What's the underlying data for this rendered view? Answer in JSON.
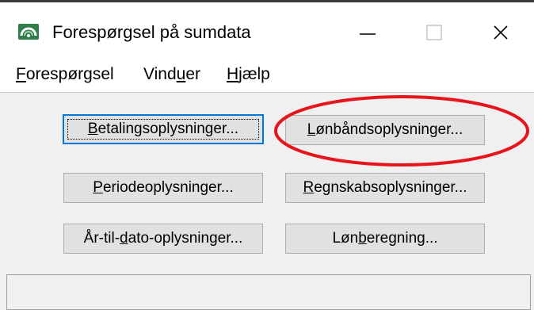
{
  "window": {
    "title": "Forespørgsel på sumdata",
    "app_icon": "green-dashboard-icon"
  },
  "titlebar_controls": {
    "minimize": "minimize-icon",
    "maximize": "maximize-icon",
    "close": "close-icon"
  },
  "menu": {
    "items": [
      {
        "first": "F",
        "rest": "orespørgsel",
        "underline_pos": "first"
      },
      {
        "pre": "Vind",
        "underlined": "u",
        "post": "er"
      },
      {
        "first": "H",
        "rest": "jælp",
        "underline_pos": "first"
      }
    ]
  },
  "buttons": {
    "betaling": {
      "pre": "",
      "ul": "B",
      "post": "etalingsoplysninger..."
    },
    "lonbands": {
      "pre": "",
      "ul": "L",
      "post": "ønbåndsoplysninger..."
    },
    "periode": {
      "pre": "",
      "ul": "P",
      "post": "eriodeoplysninger..."
    },
    "regnskab": {
      "pre": "",
      "ul": "R",
      "post": "egnskabsoplysninger..."
    },
    "aartildato": {
      "pre": "År-til-",
      "ul": "d",
      "post": "ato-oplysninger..."
    },
    "lonberegning": {
      "pre": "Løn",
      "ul": "b",
      "post": "eregning..."
    }
  },
  "colors": {
    "highlight_ellipse": "#e8141c",
    "default_button_border": "#0078d7",
    "app_icon_bg": "#2e7d4a"
  },
  "status_text": ""
}
